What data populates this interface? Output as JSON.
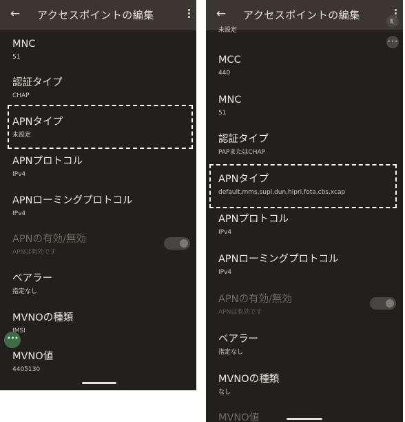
{
  "left": {
    "appbar": {
      "back_icon": "arrow-back-icon",
      "title": "アクセスポイントの編集",
      "more_icon": "more-vert-icon"
    },
    "items": [
      {
        "title": "MNC",
        "summary": "51"
      },
      {
        "title": "認証タイプ",
        "summary": "CHAP"
      },
      {
        "title": "APNタイプ",
        "summary": "未設定"
      },
      {
        "title": "APNプロトコル",
        "summary": "IPv4"
      },
      {
        "title": "APNローミングプロトコル",
        "summary": "IPv4"
      },
      {
        "title": "APNの有効/無効",
        "summary": "APNは有効です"
      },
      {
        "title": "ベアラー",
        "summary": "指定なし"
      },
      {
        "title": "MVNOの種類",
        "summary": "IMSI"
      },
      {
        "title": "MVNO値",
        "summary": "4405130"
      }
    ],
    "fab_glyph": "•••"
  },
  "right": {
    "appbar": {
      "back_icon": "arrow-back-icon",
      "title": "アクセスポイントの編集",
      "more_icon": "more-vert-icon"
    },
    "cut_summary": "未設定",
    "items": [
      {
        "title": "MCC",
        "summary": "440"
      },
      {
        "title": "MNC",
        "summary": "51"
      },
      {
        "title": "認証タイプ",
        "summary": "PAPまたはCHAP"
      },
      {
        "title": "APNタイプ",
        "summary": "default,mms,supl,dun,hipri,fota,cbs,xcap"
      },
      {
        "title": "APNプロトコル",
        "summary": "IPv4"
      },
      {
        "title": "APNローミングプロトコル",
        "summary": "IPv4"
      },
      {
        "title": "APNの有効/無効",
        "summary": "APNは有効です"
      },
      {
        "title": "ベアラー",
        "summary": "指定なし"
      },
      {
        "title": "MVNOの種類",
        "summary": "なし"
      },
      {
        "title": "MVNO値",
        "summary": ""
      }
    ],
    "fab_glyph": "•••"
  }
}
